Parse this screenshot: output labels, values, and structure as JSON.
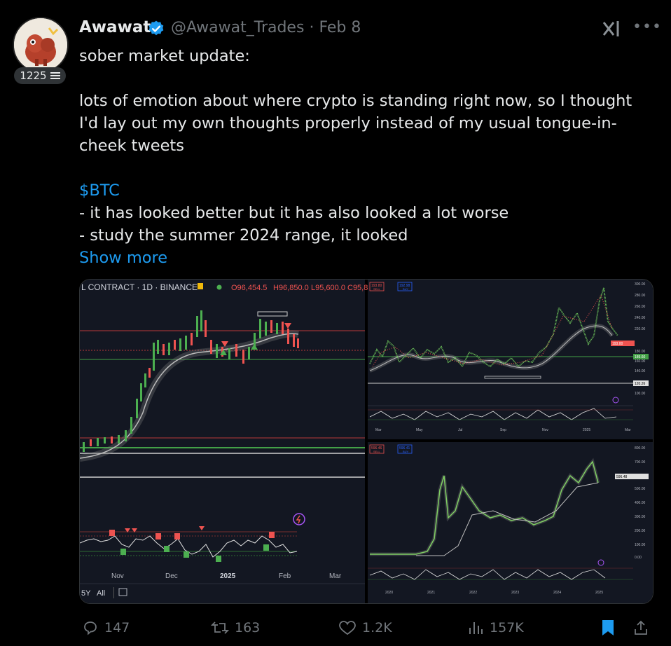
{
  "author": {
    "display_name": "Awawat",
    "handle": "@Awawat_Trades",
    "separator": "·",
    "date": "Feb 8",
    "subscriber_count": "1225"
  },
  "post": {
    "line1": "sober market update:",
    "line2": "lots of emotion about where crypto is standing right now, so I thought I'd lay out my own thoughts properly instead of my usual tongue-in-cheek tweets",
    "cashtag": "$BTC",
    "bullet1": "- it has looked better but it has also looked a lot worse",
    "bullet2": "- study the summer 2024 range, it looked",
    "show_more": "Show more"
  },
  "chart_left": {
    "header_symbol": "L CONTRACT · 1D · BINANCE",
    "header_ohlc_o": "O96,454.5",
    "header_ohlc_h": "H96,850.0",
    "header_ohlc_l": "L95,600.0",
    "header_ohlc_c": "C95,8",
    "x_ticks": [
      "Nov",
      "Dec",
      "2025",
      "Feb",
      "Mar"
    ],
    "range_buttons": [
      "5Y",
      "All"
    ]
  },
  "chart_right_top": {
    "sell_label": "193.80",
    "buy_label": "192.98",
    "sell_word": "SELL",
    "buy_word": "BUY",
    "y_ticks": [
      "300.00",
      "280.00",
      "260.00",
      "240.00",
      "220.00",
      "200.00",
      "180.00",
      "160.00",
      "140.00",
      "120.00",
      "100.00"
    ],
    "price_tag": "193.00",
    "green_tag": "189.60",
    "white_tag": "120.26",
    "x_ticks": [
      "Mar",
      "May",
      "Jul",
      "Sep",
      "Nov",
      "2025",
      "Mar"
    ]
  },
  "chart_right_bottom": {
    "sell_label": "596.46",
    "buy_label": "596.41",
    "sell_word": "SELL",
    "buy_word": "BUY",
    "y_ticks": [
      "800.00",
      "700.00",
      "600.00",
      "500.00",
      "400.00",
      "300.00",
      "200.00",
      "100.00",
      "0.00"
    ],
    "price_tag": "596.48",
    "x_ticks": [
      "2020",
      "2021",
      "2022",
      "2023",
      "2024",
      "2025"
    ]
  },
  "actions": {
    "replies": "147",
    "reposts": "163",
    "likes": "1.2K",
    "views": "157K"
  },
  "colors": {
    "accent": "#1d9bf0",
    "muted": "#71767b",
    "candle_up": "#4caf50",
    "candle_down": "#ef5350"
  }
}
